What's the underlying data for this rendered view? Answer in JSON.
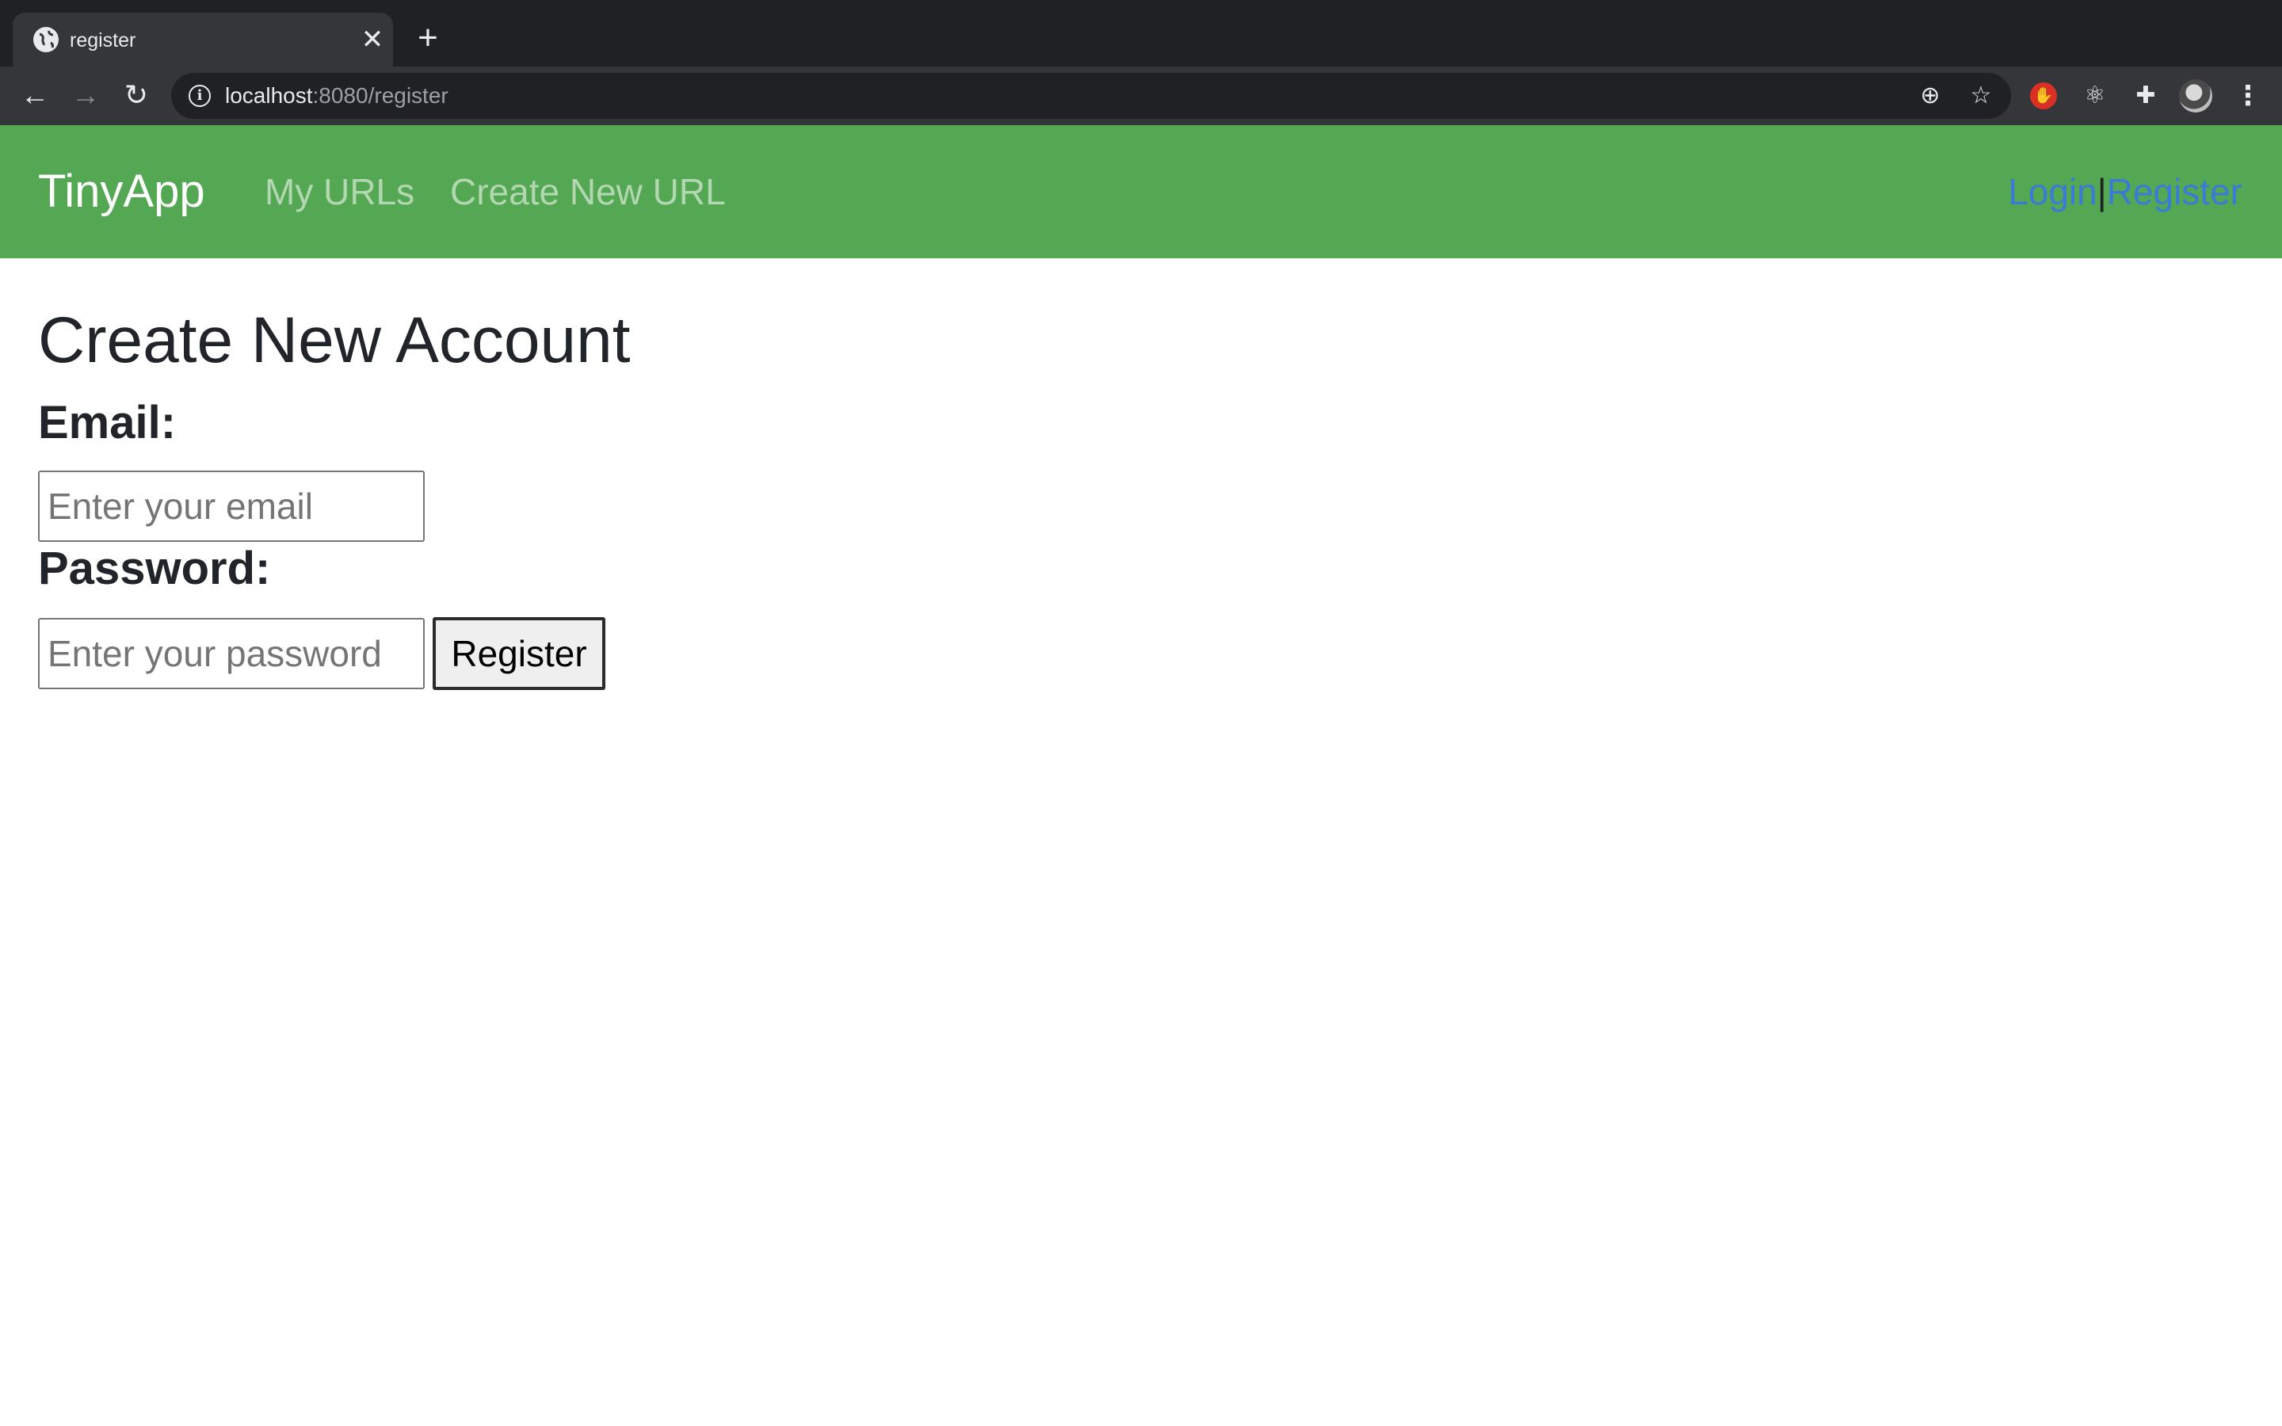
{
  "browser": {
    "tab_title": "register",
    "close_glyph": "✕",
    "new_tab_glyph": "+",
    "back_glyph": "←",
    "forward_glyph": "→",
    "reload_glyph": "↻",
    "url_host": "localhost",
    "url_rest": ":8080/register",
    "info_glyph": "i",
    "zoom_glyph": "⊕",
    "star_glyph": "☆",
    "react_glyph": "⚛",
    "puzzle_glyph": "✚",
    "stop_glyph": "✋",
    "menu_glyph": "⋮"
  },
  "navbar": {
    "brand": "TinyApp",
    "links": [
      {
        "label": "My URLs"
      },
      {
        "label": "Create New URL"
      }
    ],
    "login": "Login",
    "separator": "|",
    "register": "Register",
    "background_color": "#54a753"
  },
  "form": {
    "title": "Create New Account",
    "email_label": "Email:",
    "email_placeholder": "Enter your email",
    "password_label": "Password:",
    "password_placeholder": "Enter your password",
    "submit_label": "Register"
  }
}
